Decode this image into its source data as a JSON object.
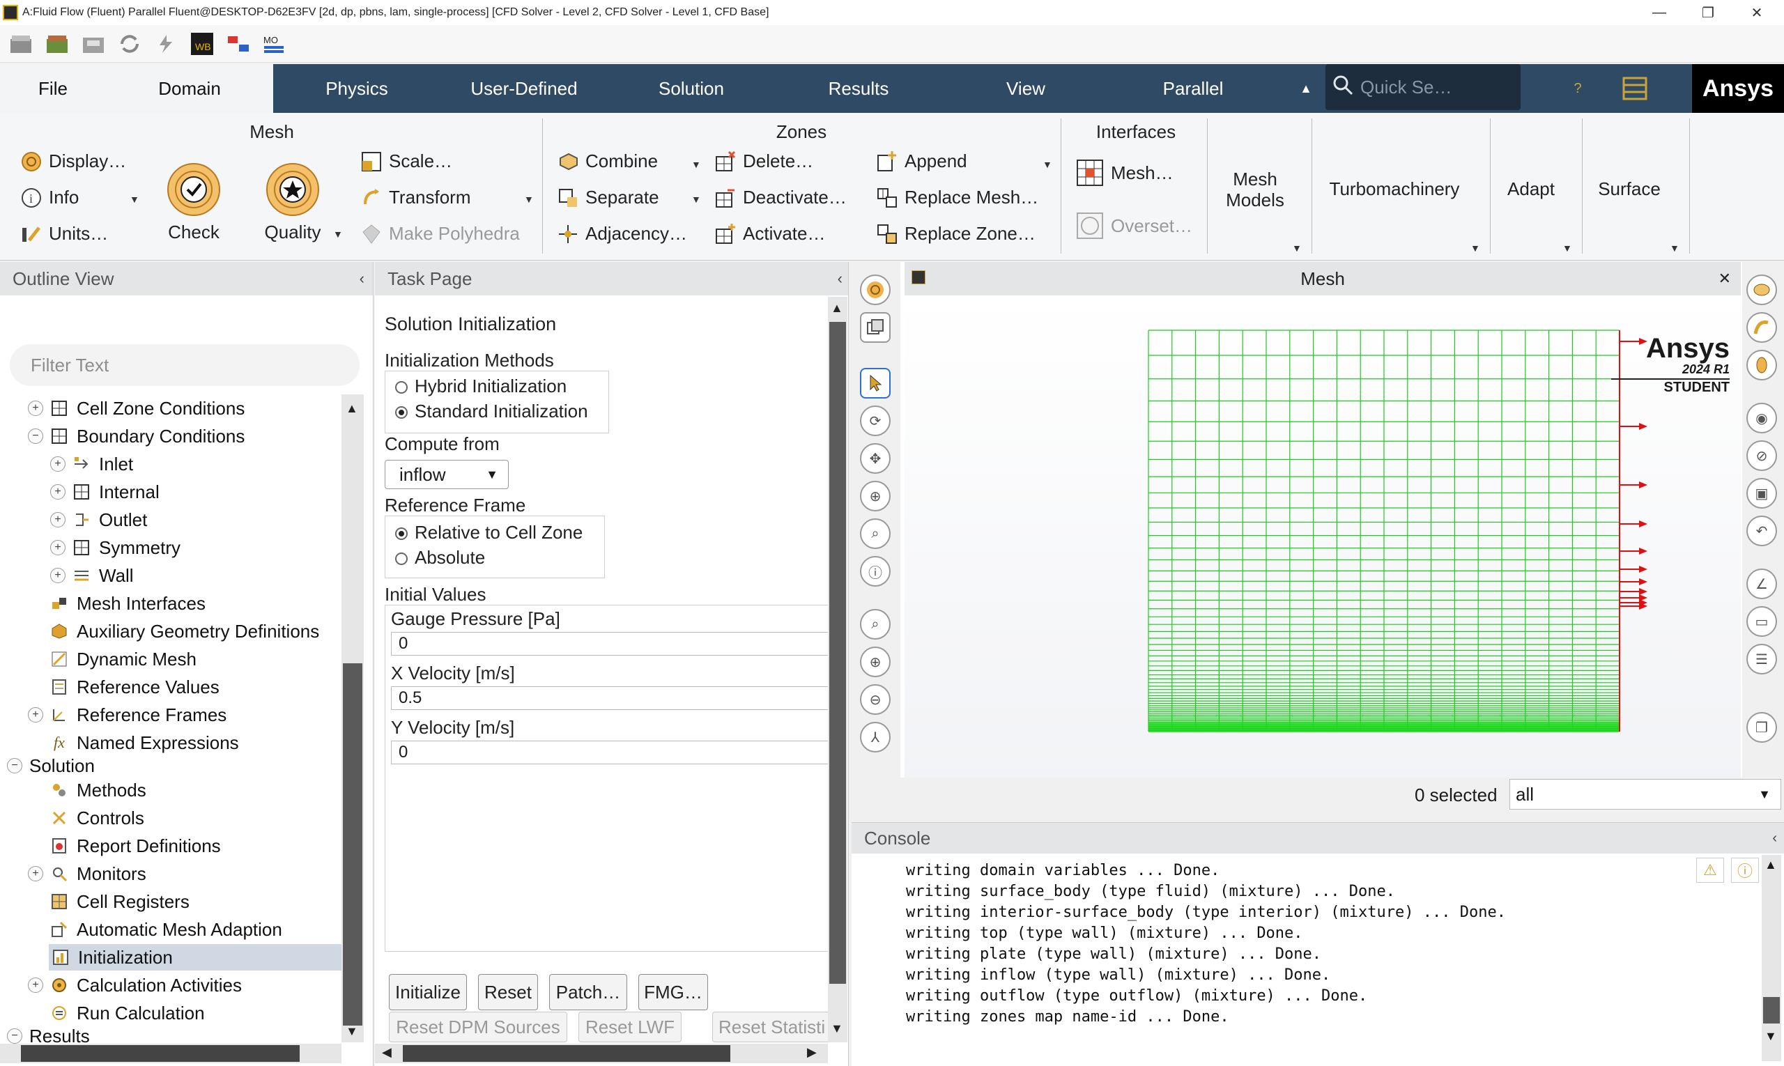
{
  "window": {
    "title": "A:Fluid Flow (Fluent) Parallel Fluent@DESKTOP-D62E3FV  [2d, dp, pbns, lam, single-process] [CFD Solver - Level 2, CFD Solver - Level 1, CFD Base]",
    "minimize": "—",
    "maximize": "❐",
    "close": "✕"
  },
  "tabs": {
    "file": "File",
    "domain": "Domain",
    "physics": "Physics",
    "user_defined": "User-Defined",
    "solution": "Solution",
    "results": "Results",
    "view": "View",
    "parallel": "Parallel",
    "search_placeholder": "Quick Se…",
    "brand": "Ansys"
  },
  "ribbon": {
    "mesh": {
      "title": "Mesh",
      "display": "Display…",
      "info": "Info",
      "units": "Units…",
      "check": "Check",
      "quality": "Quality",
      "scale": "Scale…",
      "transform": "Transform",
      "make_polyhedra": "Make Polyhedra"
    },
    "zones": {
      "title": "Zones",
      "combine": "Combine",
      "separate": "Separate",
      "adjacency": "Adjacency…",
      "delete": "Delete…",
      "deactivate": "Deactivate…",
      "activate": "Activate…",
      "append": "Append",
      "replace_mesh": "Replace Mesh…",
      "replace_zone": "Replace Zone…"
    },
    "interfaces": {
      "title": "Interfaces",
      "mesh": "Mesh…",
      "overset": "Overset…"
    },
    "mesh_models": "Mesh\nModels",
    "turbomachinery": "Turbomachinery",
    "adapt": "Adapt",
    "surface": "Surface"
  },
  "outline": {
    "title": "Outline View",
    "filter_placeholder": "Filter Text",
    "items": [
      {
        "label": "Cell Zone Conditions"
      },
      {
        "label": "Boundary Conditions"
      },
      {
        "label": "Inlet"
      },
      {
        "label": "Internal"
      },
      {
        "label": "Outlet"
      },
      {
        "label": "Symmetry"
      },
      {
        "label": "Wall"
      },
      {
        "label": "Mesh Interfaces"
      },
      {
        "label": "Auxiliary Geometry Definitions"
      },
      {
        "label": "Dynamic Mesh"
      },
      {
        "label": "Reference Values"
      },
      {
        "label": "Reference Frames"
      },
      {
        "label": "Named Expressions"
      },
      {
        "label": "Solution"
      },
      {
        "label": "Methods"
      },
      {
        "label": "Controls"
      },
      {
        "label": "Report Definitions"
      },
      {
        "label": "Monitors"
      },
      {
        "label": "Cell Registers"
      },
      {
        "label": "Automatic Mesh Adaption"
      },
      {
        "label": "Initialization"
      },
      {
        "label": "Calculation Activities"
      },
      {
        "label": "Run Calculation"
      },
      {
        "label": "Results"
      }
    ]
  },
  "task": {
    "title": "Task Page",
    "heading": "Solution Initialization",
    "init_methods_label": "Initialization Methods",
    "hybrid": "Hybrid  Initialization",
    "standard": "Standard Initialization",
    "compute_from_label": "Compute from",
    "compute_from_value": "inflow",
    "ref_frame_label": "Reference Frame",
    "relative": "Relative to Cell Zone",
    "absolute": "Absolute",
    "initial_values_label": "Initial Values",
    "gauge_label": "Gauge Pressure [Pa]",
    "gauge_value": "0",
    "xvel_label": "X Velocity [m/s]",
    "xvel_value": "0.5",
    "yvel_label": "Y Velocity [m/s]",
    "yvel_value": "0",
    "btn_initialize": "Initialize",
    "btn_reset": "Reset",
    "btn_patch": "Patch…",
    "btn_fmg": "FMG…",
    "btn_reset_dpm": "Reset DPM Sources",
    "btn_reset_lwf": "Reset LWF",
    "btn_reset_stats": "Reset Statisti"
  },
  "graphics": {
    "title": "Mesh",
    "close": "✕",
    "brand": "Ansys",
    "version": "2024 R1",
    "edition": "STUDENT",
    "selected_count": "0 selected",
    "selection_filter": "all",
    "mesh_color": "#1ccb1c",
    "boundary_color": "#dd1111"
  },
  "console": {
    "title": "Console",
    "lines": [
      "writing domain variables ... Done.",
      "writing surface_body (type fluid) (mixture) ... Done.",
      "writing interior-surface_body (type interior) (mixture) ... Done.",
      "writing top (type wall) (mixture) ... Done.",
      "writing plate (type wall) (mixture) ... Done.",
      "writing inflow (type wall) (mixture) ... Done.",
      "writing outflow (type outflow) (mixture) ... Done.",
      "writing zones map name-id ... Done."
    ]
  }
}
